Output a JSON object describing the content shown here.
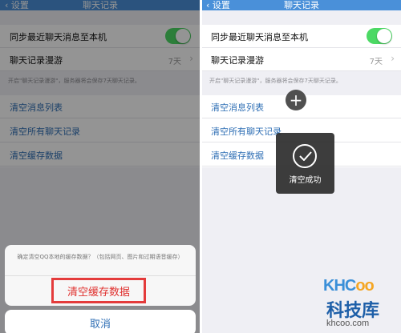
{
  "left": {
    "nav": {
      "back": "设置",
      "title": "聊天记录"
    },
    "rows": {
      "sync": "同步最近聊天消息至本机",
      "roaming": "聊天记录漫游",
      "roaming_value": "7天",
      "note": "开启\"聊天记录漫游\"，服务器将会保存7天聊天记录。",
      "clear_list": "清空消息列表",
      "clear_all": "清空所有聊天记录",
      "clear_cache": "清空缓存数据"
    },
    "sheet": {
      "message": "确定清空QQ本地的缓存数据？（包括网页、图片和过期语音缓存）",
      "confirm": "清空缓存数据",
      "cancel": "取消"
    }
  },
  "right": {
    "nav": {
      "back": "设置",
      "title": "聊天记录"
    },
    "rows": {
      "sync": "同步最近聊天消息至本机",
      "roaming": "聊天记录漫游",
      "roaming_value": "7天",
      "note": "开启\"聊天记录漫游\"，服务器将会保存7天聊天记录。",
      "clear_list": "清空消息列表",
      "clear_all": "清空所有聊天记录",
      "clear_cache": "清空缓存数据"
    },
    "plus": "+",
    "toast": "清空成功"
  },
  "watermark": {
    "logo_kh": "KHC",
    "logo_oo": "oo",
    "chinese": "科技库",
    "url": "khcoo.com"
  },
  "colors": {
    "nav": "#4a90d9",
    "toggle": "#4cd964",
    "link": "#2f6fb5",
    "danger": "#e43b3b"
  }
}
